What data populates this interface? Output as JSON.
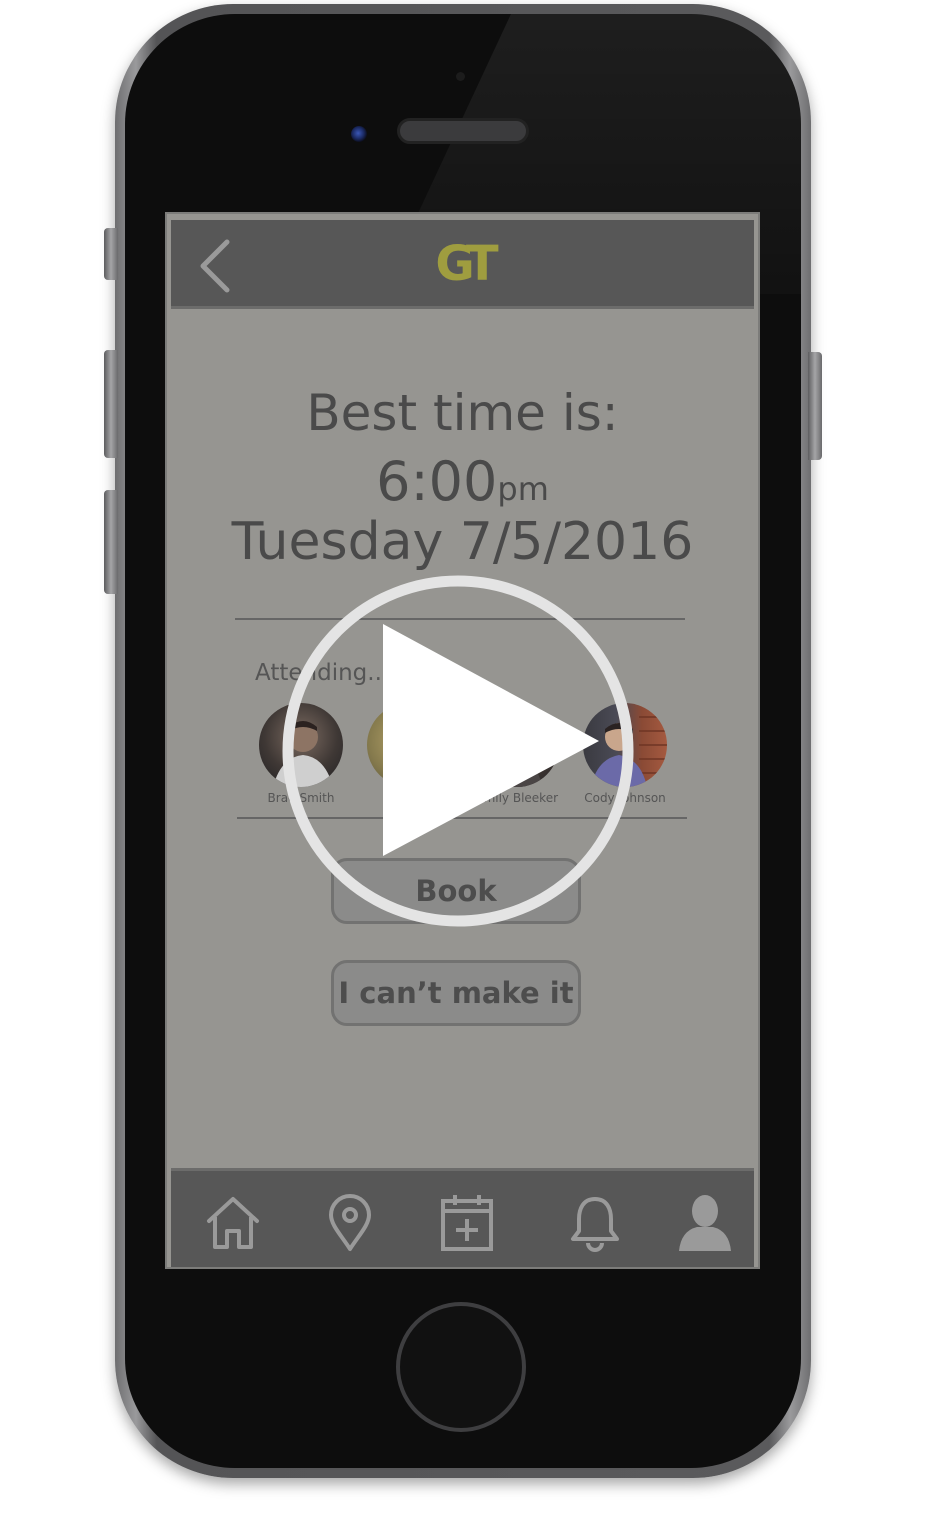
{
  "app": {
    "logo_text": "GT",
    "accent_color": "#9f9d3f"
  },
  "best_time": {
    "heading": "Best time is:",
    "time": "6:00",
    "ampm": "pm",
    "date": "Tuesday 7/5/2016"
  },
  "attending": {
    "label": "Attending...",
    "people": [
      {
        "name": "Brad Smith"
      },
      {
        "name": "S"
      },
      {
        "name": "Emily Bleeker"
      },
      {
        "name": "Cody Johnson"
      }
    ]
  },
  "actions": {
    "book_label": "Book",
    "decline_label": "I can’t make it"
  },
  "bottom_nav": {
    "items": [
      {
        "icon": "home-icon"
      },
      {
        "icon": "location-pin-icon"
      },
      {
        "icon": "calendar-add-icon"
      },
      {
        "icon": "bell-icon"
      },
      {
        "icon": "profile-icon"
      }
    ]
  },
  "overlay": {
    "icon": "play-icon"
  }
}
